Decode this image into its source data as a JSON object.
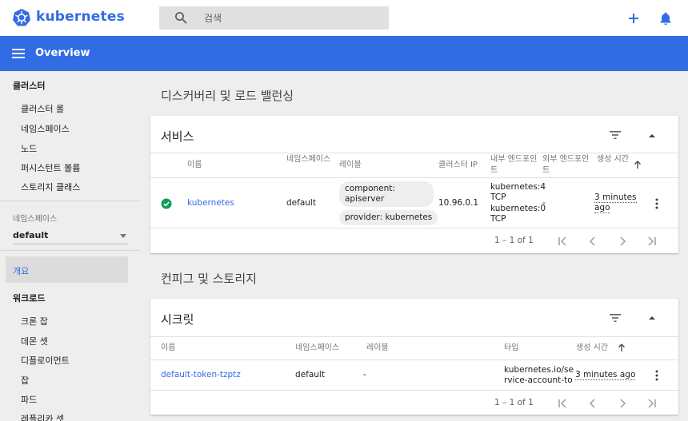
{
  "topbar": {
    "brand": "kubernetes",
    "search_placeholder": "검색"
  },
  "header": {
    "title": "Overview"
  },
  "sidebar": {
    "cluster_heading": "클러스터",
    "cluster_items": [
      "클러스터 롤",
      "네임스페이스",
      "노드",
      "퍼시스턴트 볼륨",
      "스토리지 클래스"
    ],
    "namespace_label": "네임스페이스",
    "namespace_value": "default",
    "overview": "개요",
    "workload_heading": "워크로드",
    "workload_items": [
      "크론 잡",
      "데몬 셋",
      "디플로이먼트",
      "잡",
      "파드",
      "레플리카 셋"
    ]
  },
  "main": {
    "discovery_title": "디스커버리 및 로드 밸런싱",
    "config_title": "컨피그 및 스토리지"
  },
  "services": {
    "title": "서비스",
    "headers": {
      "name": "이름",
      "namespace": "네임스페이스",
      "labels": "레이블",
      "cluster_ip": "클러스터 IP",
      "internal_endpoints": "내부 엔드포인트",
      "external_endpoints": "외부 엔드포인트",
      "age": "생성 시간"
    },
    "rows": [
      {
        "name": "kubernetes",
        "namespace": "default",
        "labels": [
          "component: apiserver",
          "provider: kubernetes"
        ],
        "cluster_ip": "10.96.0.1",
        "internal_endpoints": [
          "kubernetes:4 TCP",
          "kubernetes:0 TCP"
        ],
        "external_endpoints": "-",
        "age": "3 minutes ago",
        "status": "ok"
      }
    ],
    "pagination": "1 – 1 of 1"
  },
  "secrets": {
    "title": "시크릿",
    "headers": {
      "name": "이름",
      "namespace": "네임스페이스",
      "labels": "레이블",
      "type": "타입",
      "age": "생성 시간"
    },
    "rows": [
      {
        "name": "default-token-tzptz",
        "namespace": "default",
        "labels": "-",
        "type": "kubernetes.io/service-account-token",
        "age": "3 minutes ago"
      }
    ],
    "pagination": "1 – 1 of 1"
  },
  "colors": {
    "brand": "#326ce5",
    "ok": "#0f9d58"
  }
}
